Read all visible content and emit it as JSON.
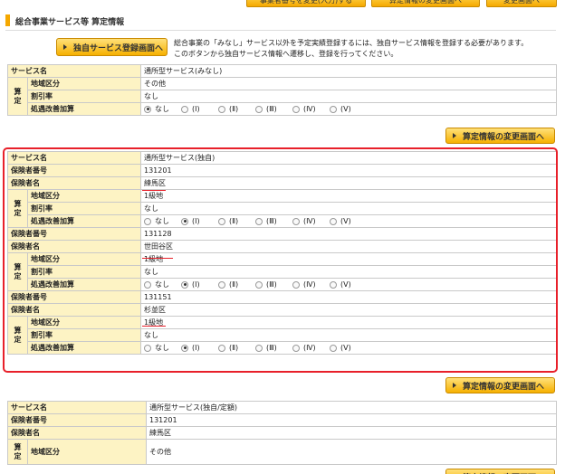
{
  "top_buttons": [
    "事業者番号を変更(入力)する",
    "算定情報の変更画面へ",
    "変更画面へ"
  ],
  "section": {
    "title": "総合事業サービス等 算定情報"
  },
  "register_button": "独自サービス登録画面へ",
  "note": [
    "総合事業の「みなし」サービス以外を予定実績登録するには、独自サービス情報を登録する必要があります。",
    "このボタンから独自サービス情報へ遷移し、登録を行ってください。"
  ],
  "labels": {
    "service_name": "サービス名",
    "insurer_no": "保険者番号",
    "insurer_name": "保険者名",
    "santei": "算定",
    "area": "地域区分",
    "discount": "割引率",
    "treatment": "処遇改善加算"
  },
  "radio_options": [
    "なし",
    "(Ⅰ)",
    "(Ⅱ)",
    "(Ⅲ)",
    "(Ⅳ)",
    "(Ⅴ)"
  ],
  "change_button": "算定情報の変更画面へ",
  "block1": {
    "service_name": "通所型サービス(みなし)",
    "area": "その他",
    "discount": "なし",
    "treatment_selected": 0
  },
  "block2": {
    "service_name": "通所型サービス(独自)",
    "insurers": [
      {
        "no": "131201",
        "name": "練馬区",
        "area": "1級地",
        "discount": "なし",
        "treatment_selected": 1
      },
      {
        "no": "131128",
        "name": "世田谷区",
        "area": "1級地",
        "discount": "なし",
        "treatment_selected": 1
      },
      {
        "no": "131151",
        "name": "杉並区",
        "area": "1級地",
        "discount": "なし",
        "treatment_selected": 1
      }
    ]
  },
  "block3": {
    "service_name": "通所型サービス(独自/定額)",
    "insurer_no": "131201",
    "insurer_name": "練馬区",
    "area": "その他"
  }
}
